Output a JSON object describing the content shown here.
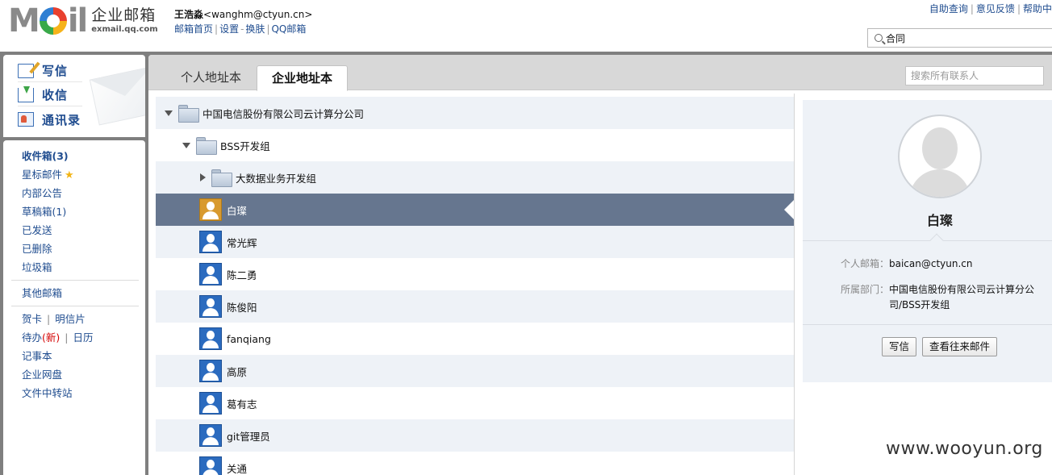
{
  "header": {
    "logo_text": "MAIL",
    "logo_cn": "企业邮箱",
    "logo_en": "exmail.qq.com",
    "user_name": "王浩淼",
    "user_email": "<wanghm@ctyun.cn>",
    "links": [
      "邮箱首页",
      "设置",
      "换肤",
      "QQ邮箱"
    ],
    "top_links": [
      "自助查询",
      "意见反馈",
      "帮助中"
    ],
    "search_value": "合同"
  },
  "compose": {
    "write": "写信",
    "inbox": "收信",
    "contacts": "通讯录"
  },
  "sidebar": {
    "inbox": "收件箱(3)",
    "starred": "星标邮件",
    "bulletin": "内部公告",
    "drafts_label": "草稿箱",
    "drafts_count": "(1)",
    "sent": "已发送",
    "deleted": "已删除",
    "junk": "垃圾箱",
    "other": "其他邮箱",
    "greeting": "贺卡",
    "postcard": "明信片",
    "todo": "待办",
    "todo_new": "(新)",
    "calendar": "日历",
    "notes": "记事本",
    "netdisk": "企业网盘",
    "transfer": "文件中转站"
  },
  "tabs": {
    "personal": "个人地址本",
    "enterprise": "企业地址本",
    "search_placeholder": "搜索所有联系人"
  },
  "tree": {
    "company": "中国电信股份有限公司云计算分公司",
    "group": "BSS开发组",
    "subgroup": "大数据业务开发组",
    "contacts": [
      "白璨",
      "常光辉",
      "陈二勇",
      "陈俊阳",
      "fanqiang",
      "高原",
      "葛有志",
      "git管理员",
      "关通"
    ]
  },
  "detail": {
    "name": "白璨",
    "email_label": "个人邮箱：",
    "email": "baican@ctyun.cn",
    "dept_label": "所属部门：",
    "dept": "中国电信股份有限公司云计算分公司/BSS开发组",
    "btn_write": "写信",
    "btn_history": "查看往来邮件"
  },
  "watermark": "www.wooyun.org"
}
